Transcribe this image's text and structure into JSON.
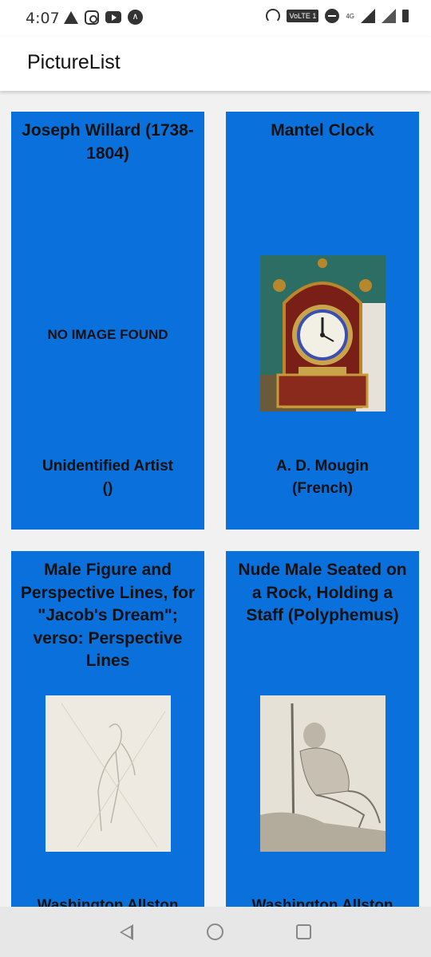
{
  "status_bar": {
    "time": "4:07",
    "volte_label": "VoLTE 1",
    "network_label": "4G",
    "left_icons": [
      "warning-icon",
      "instagram-icon",
      "youtube-icon",
      "app-icon"
    ],
    "right_icons": [
      "hotspot-icon",
      "volte-icon",
      "dnd-icon",
      "signal-icon",
      "signal-icon",
      "battery-icon"
    ]
  },
  "app_bar": {
    "title": "PictureList"
  },
  "cards": [
    {
      "title": "Joseph Willard (1738-1804)",
      "image_placeholder": "NO IMAGE FOUND",
      "artist_name": "Unidentified Artist",
      "artist_nationality": "()"
    },
    {
      "title": "Mantel Clock",
      "artist_name": "A. D. Mougin",
      "artist_nationality": "(French)"
    },
    {
      "title": "Male Figure and Perspective Lines, for \"Jacob's Dream\"; verso: Perspective Lines",
      "artist_name": "Washington Allston"
    },
    {
      "title": "Nude Male Seated on a Rock, Holding a Staff (Polyphemus)",
      "artist_name": "Washington Allston"
    }
  ],
  "colors": {
    "card_background": "#0a70db",
    "page_background": "#f1f1f1"
  },
  "nav_bar": {
    "icons": [
      "back-icon",
      "home-icon",
      "recent-apps-icon"
    ]
  }
}
